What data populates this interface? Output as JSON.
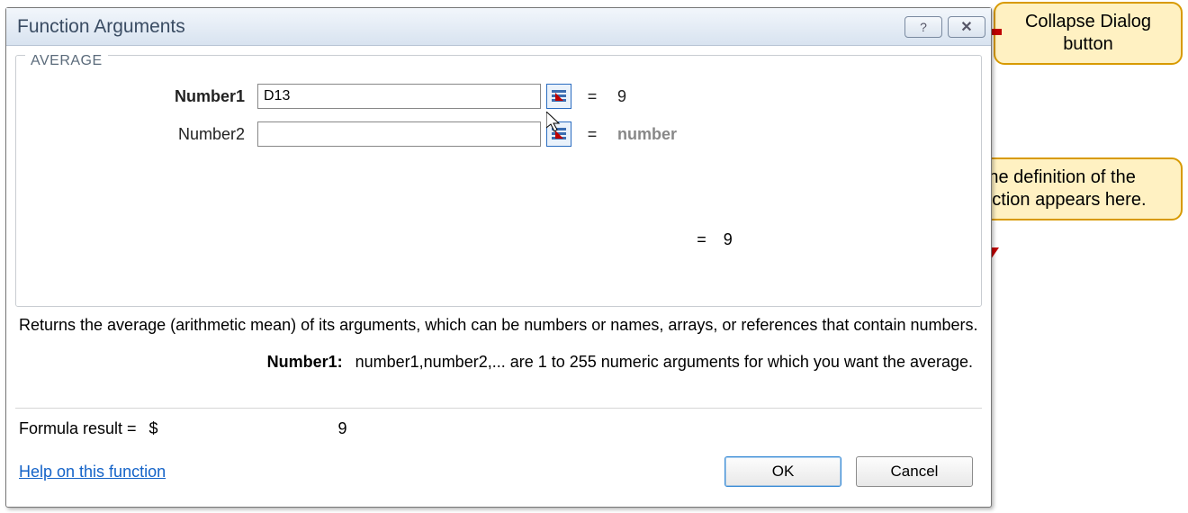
{
  "dialog": {
    "title": "Function Arguments",
    "function_name": "AVERAGE",
    "arguments": [
      {
        "label": "Number1",
        "value": "D13",
        "result": "9",
        "bold": true,
        "result_grey": false
      },
      {
        "label": "Number2",
        "value": "",
        "result": "number",
        "bold": false,
        "result_grey": true
      }
    ],
    "intermediate_result": "9",
    "description": "Returns the average (arithmetic mean) of its arguments, which can be numbers or names, arrays, or references that contain numbers.",
    "arg_detail": {
      "name": "Number1:",
      "text": "number1,number2,... are 1 to 255 numeric arguments for which you want the average."
    },
    "formula_result_label": "Formula result =",
    "formula_result_currency": "$",
    "formula_result_value": "9",
    "help_link": "Help on this function",
    "ok_label": "OK",
    "cancel_label": "Cancel",
    "help_btn_glyph": "?",
    "close_btn_glyph": "✕",
    "eq_glyph": "="
  },
  "annotations": {
    "callout_collapse": "Collapse Dialog button",
    "callout_definition": "The definition of the function appears here."
  }
}
